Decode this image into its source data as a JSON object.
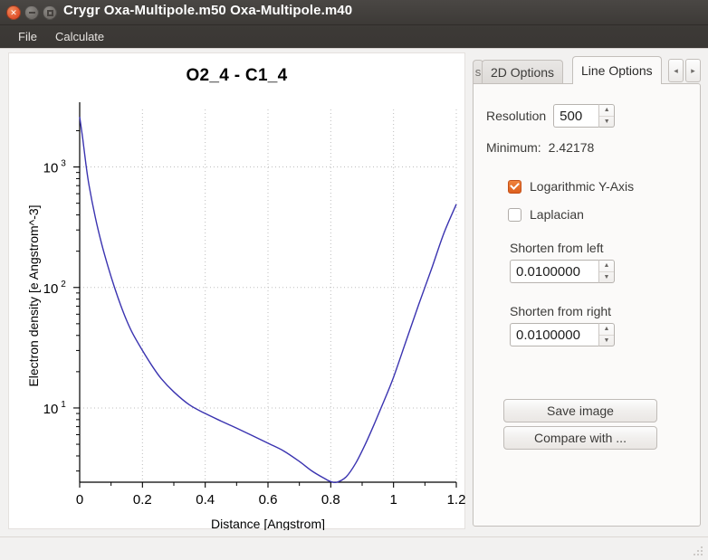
{
  "window": {
    "title": "Crygr Oxa-Multipole.m50 Oxa-Multipole.m40",
    "close_icon": "close-icon",
    "minimize_icon": "minimize-icon",
    "maximize_icon": "maximize-icon"
  },
  "menubar": {
    "items": [
      {
        "label": "File"
      },
      {
        "label": "Calculate"
      }
    ]
  },
  "tabs": {
    "stub_label": "s",
    "items": [
      {
        "label": "2D Options",
        "active": false
      },
      {
        "label": "Line Options",
        "active": true
      }
    ],
    "scroll_left": "◂",
    "scroll_right": "▸"
  },
  "line_options": {
    "resolution_label": "Resolution",
    "resolution_value": "500",
    "minimum_label": "Minimum:",
    "minimum_value": "2.42178",
    "log_y_label": "Logarithmic Y-Axis",
    "log_y_checked": true,
    "laplacian_label": "Laplacian",
    "laplacian_checked": false,
    "shorten_left_label": "Shorten from left",
    "shorten_left_value": "0.0100000",
    "shorten_right_label": "Shorten from right",
    "shorten_right_value": "0.0100000",
    "save_image_label": "Save image",
    "compare_with_label": "Compare with ..."
  },
  "chart_data": {
    "type": "line",
    "title": "O2_4 - C1_4",
    "xlabel": "Distance [Angstrom]",
    "ylabel": "Electron density [e Angstrom^-3]",
    "xlim": [
      0,
      1.2
    ],
    "xticks": [
      0,
      0.2,
      0.4,
      0.6,
      0.8,
      1,
      1.2
    ],
    "xticklabels": [
      "0",
      "0.2",
      "0.4",
      "0.6",
      "0.8",
      "1",
      "1.2"
    ],
    "yscale": "log",
    "ylim": [
      2.42178,
      3000
    ],
    "yticks": [
      10,
      100,
      1000
    ],
    "yticklabels": [
      "10¹",
      "10²",
      "10³"
    ],
    "ytick_mantissa": "10",
    "ytick_exponents": [
      "1",
      "2",
      "3"
    ],
    "grid": true,
    "legend": "none",
    "line_color": "#3a33b0",
    "series": [
      {
        "name": "Electron density",
        "x": [
          0.0,
          0.01,
          0.02,
          0.03,
          0.05,
          0.07,
          0.09,
          0.11,
          0.13,
          0.15,
          0.17,
          0.2,
          0.23,
          0.26,
          0.3,
          0.35,
          0.4,
          0.45,
          0.5,
          0.55,
          0.6,
          0.65,
          0.7,
          0.74,
          0.78,
          0.8,
          0.82,
          0.85,
          0.88,
          0.91,
          0.94,
          0.97,
          1.0,
          1.04,
          1.08,
          1.12,
          1.16,
          1.2
        ],
        "y": [
          2600,
          1700,
          1050,
          700,
          380,
          230,
          150,
          102,
          72,
          53,
          41,
          30.0,
          22.5,
          17.5,
          13.6,
          10.6,
          9.0,
          7.8,
          6.8,
          5.9,
          5.1,
          4.4,
          3.6,
          3.0,
          2.6,
          2.45,
          2.42,
          2.7,
          3.5,
          5.0,
          7.5,
          11.5,
          18.0,
          36,
          72,
          140,
          280,
          490
        ]
      }
    ]
  }
}
